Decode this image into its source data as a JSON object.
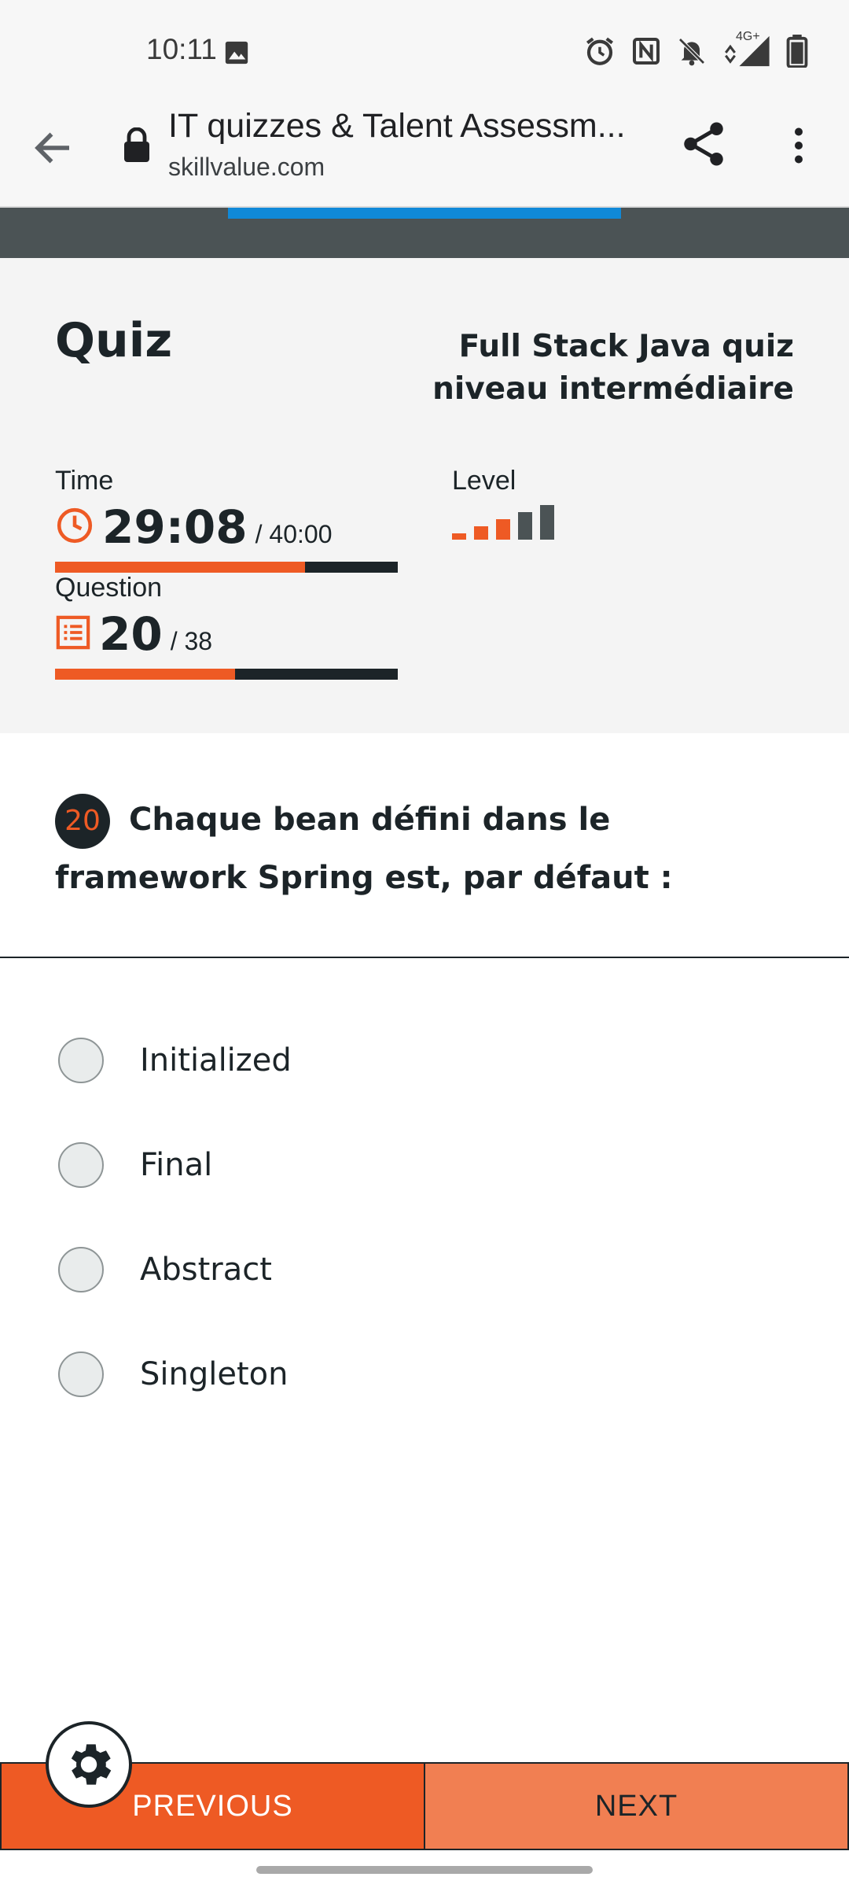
{
  "status_bar": {
    "time": "10:11",
    "icons": [
      "image-icon",
      "alarm-icon",
      "nfc-icon",
      "bell-off-icon",
      "network-4g-icon",
      "signal-icon",
      "battery-icon"
    ],
    "network_label": "4G+"
  },
  "browser": {
    "page_title": "IT quizzes & Talent Assessm...",
    "url": "skillvalue.com",
    "icons": [
      "back-arrow-icon",
      "lock-icon",
      "share-icon",
      "more-vert-icon"
    ]
  },
  "quiz": {
    "heading": "Quiz",
    "name": "Full Stack Java quiz niveau intermédiaire",
    "time_label": "Time",
    "time_elapsed": "29:08",
    "time_total": "/ 40:00",
    "time_progress": 0.73,
    "question_label": "Question",
    "question_current": "20",
    "question_total": "/ 38",
    "question_progress": 0.526,
    "level_label": "Level",
    "level": 3,
    "level_max": 5
  },
  "question": {
    "number": "20",
    "text": "Chaque bean défini dans le framework Spring est, par défaut :"
  },
  "options": [
    {
      "label": "Initialized",
      "selected": false
    },
    {
      "label": "Final",
      "selected": false
    },
    {
      "label": "Abstract",
      "selected": false
    },
    {
      "label": "Singleton",
      "selected": false
    }
  ],
  "nav": {
    "previous_label": "PREVIOUS",
    "next_label": "NEXT",
    "settings_icon": "gear-icon"
  },
  "colors": {
    "accent": "#ee5a24",
    "dark": "#1c2428",
    "band": "#4b5355",
    "progress_blue": "#1089d8",
    "next_button": "#f17f52"
  }
}
